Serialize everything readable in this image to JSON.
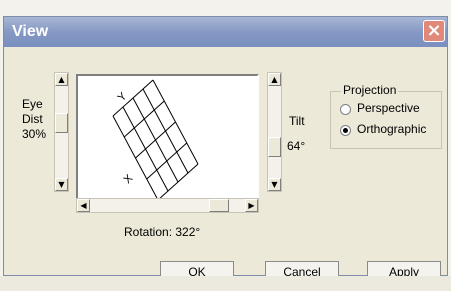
{
  "window": {
    "title": "View",
    "close_glyph": "×"
  },
  "eye_dist": {
    "label_line1": "Eye",
    "label_line2": "Dist",
    "value": "30%",
    "level": 0.3
  },
  "tilt": {
    "label": "Tilt",
    "value": "64°",
    "level": 0.64
  },
  "rotation": {
    "label": "Rotation: 322°",
    "degrees": 322
  },
  "projection": {
    "legend": "Projection",
    "options": [
      {
        "label": "Perspective",
        "checked": false
      },
      {
        "label": "Orthographic",
        "checked": true
      }
    ]
  },
  "grid_axes": {
    "y": "Y",
    "x": "X"
  },
  "buttons": {
    "ok": "OK",
    "cancel": "Cancel",
    "apply": "Apply"
  },
  "scroll_glyphs": {
    "up": "▲",
    "down": "▼",
    "left": "◀",
    "right": "▶"
  }
}
